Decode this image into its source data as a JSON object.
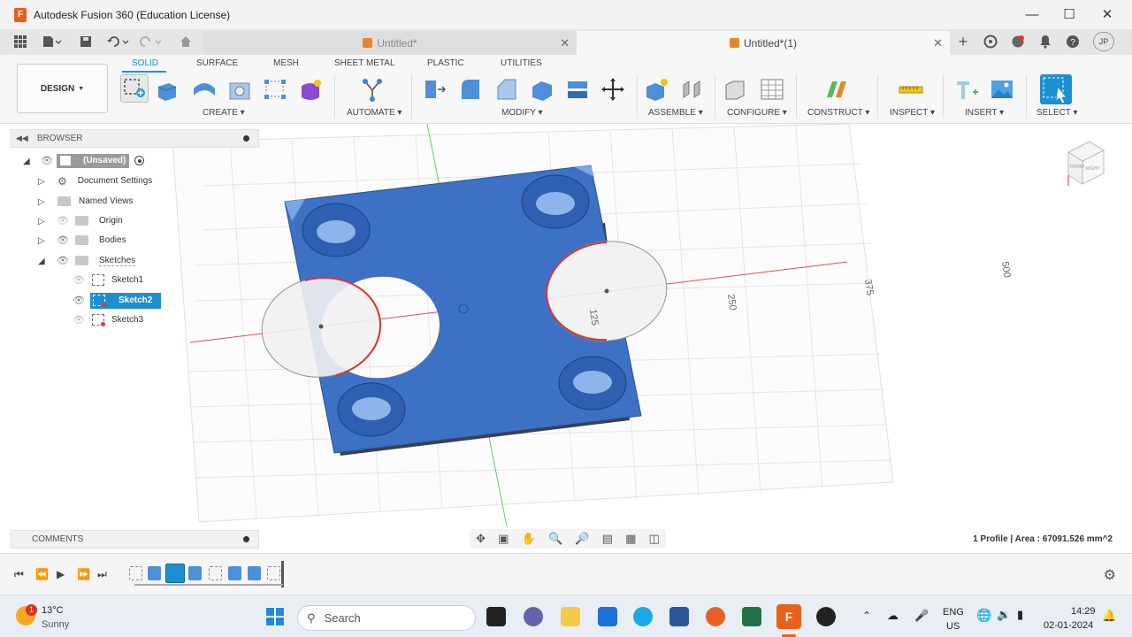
{
  "window": {
    "title": "Autodesk Fusion 360 (Education License)",
    "app_icon": "F",
    "controls": [
      "minimize-icon",
      "maximize-icon",
      "close-icon"
    ]
  },
  "quick_access": {
    "icons": [
      "grid-icon",
      "file-icon",
      "save-icon",
      "undo-icon",
      "redo-icon",
      "home-icon"
    ],
    "right_icons": [
      "plus-icon",
      "extensions-icon",
      "job-status-icon",
      "bell-icon",
      "help-icon"
    ],
    "user_initials": "JP"
  },
  "tabs": [
    {
      "label": "Untitled*",
      "active": false
    },
    {
      "label": "Untitled*(1)",
      "active": true
    }
  ],
  "ribbon": {
    "workspace": "DESIGN",
    "tabs": [
      "SOLID",
      "SURFACE",
      "MESH",
      "SHEET METAL",
      "PLASTIC",
      "UTILITIES"
    ],
    "active_tab": "SOLID",
    "groups": [
      "CREATE",
      "AUTOMATE",
      "MODIFY",
      "ASSEMBLE",
      "CONFIGURE",
      "CONSTRUCT",
      "INSPECT",
      "INSERT",
      "SELECT"
    ]
  },
  "browser": {
    "title": "BROWSER",
    "root": "(Unsaved)",
    "items": [
      "Document Settings",
      "Named Views",
      "Origin",
      "Bodies",
      "Sketches"
    ],
    "sketches": [
      "Sketch1",
      "Sketch2",
      "Sketch3"
    ],
    "selected": "Sketch2"
  },
  "viewport": {
    "dim_labels": [
      "125",
      "250",
      "375",
      "500"
    ],
    "status": "1 Profile | Area : 67091.526 mm^2",
    "viewcube_labels": [
      "FRONT",
      "RIGHT"
    ]
  },
  "comments": {
    "title": "COMMENTS"
  },
  "colors": {
    "accent": "#0696d7",
    "body": "#3d71c4",
    "selected_row": "#1d8fd1"
  },
  "taskbar": {
    "weather": {
      "temp": "13°C",
      "condition": "Sunny",
      "badge": "1"
    },
    "search_placeholder": "Search",
    "lang": "ENG",
    "region": "US",
    "time": "14:29",
    "date": "02-01-2024"
  }
}
